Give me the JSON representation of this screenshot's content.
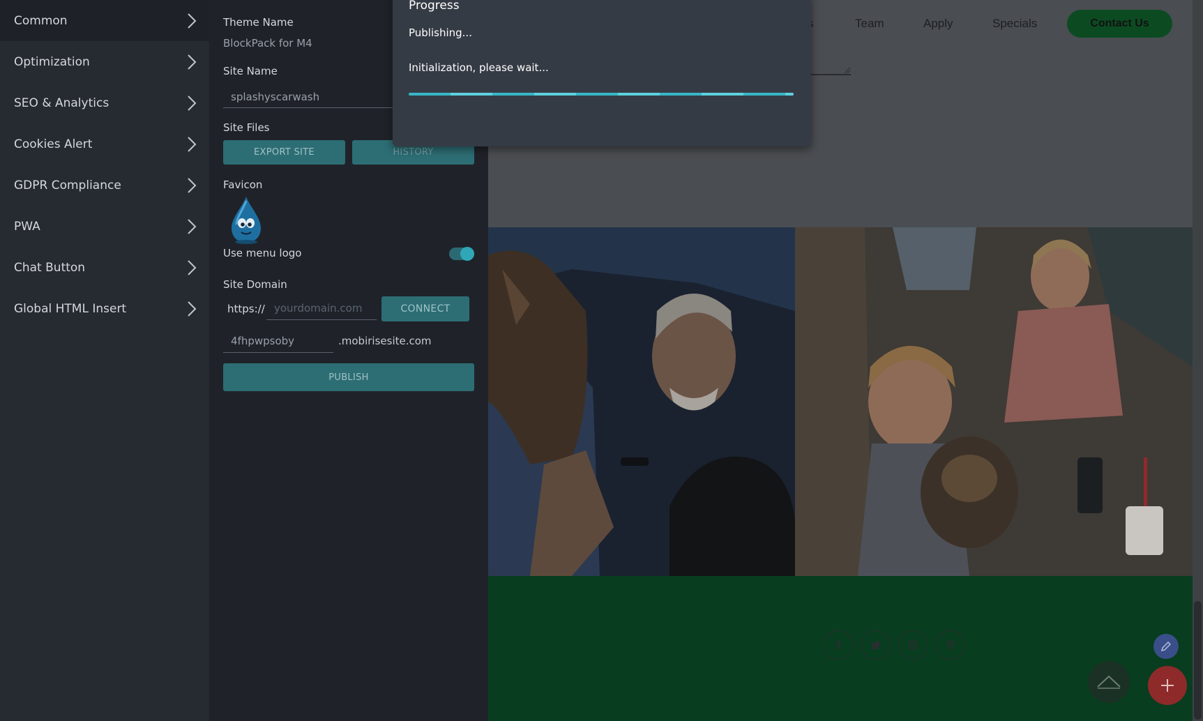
{
  "sidebar": {
    "items": [
      {
        "label": "Common"
      },
      {
        "label": "Optimization"
      },
      {
        "label": "SEO & Analytics"
      },
      {
        "label": "Cookies Alert"
      },
      {
        "label": "GDPR Compliance"
      },
      {
        "label": "PWA"
      },
      {
        "label": "Chat Button"
      },
      {
        "label": "Global HTML Insert"
      }
    ]
  },
  "settings": {
    "theme_name_label": "Theme Name",
    "theme_name_value": "BlockPack for M4",
    "site_name_label": "Site Name",
    "site_name_value": "splashyscarwash",
    "site_files_label": "Site Files",
    "export_label": "EXPORT SITE",
    "history_label": "HISTORY",
    "favicon_label": "Favicon",
    "use_menu_logo_label": "Use menu logo",
    "use_menu_logo_on": true,
    "site_domain_label": "Site Domain",
    "https_prefix": "https://",
    "domain_placeholder": "yourdomain.com",
    "connect_label": "CONNECT",
    "subdomain_value": "4fhpwpsoby",
    "subdomain_suffix": ".mobirisesite.com",
    "publish_label": "PUBLISH"
  },
  "preview": {
    "nav": {
      "partial_link": "s",
      "links": [
        "Team",
        "Apply",
        "Specials"
      ],
      "contact_label": "Contact Us"
    },
    "social_icons": [
      "facebook-icon",
      "twitter-icon",
      "instagram-icon",
      "map-pin-icon"
    ]
  },
  "modal": {
    "title": "Progress",
    "status": "Publishing...",
    "message": "Initialization, please wait...",
    "progress_fraction": 1.0
  },
  "colors": {
    "accent": "#2d6d74",
    "progress": "#38b6c6",
    "brand_green": "#0c4b22",
    "footer_green": "#083d1f",
    "add_button": "#8e2a2a"
  }
}
